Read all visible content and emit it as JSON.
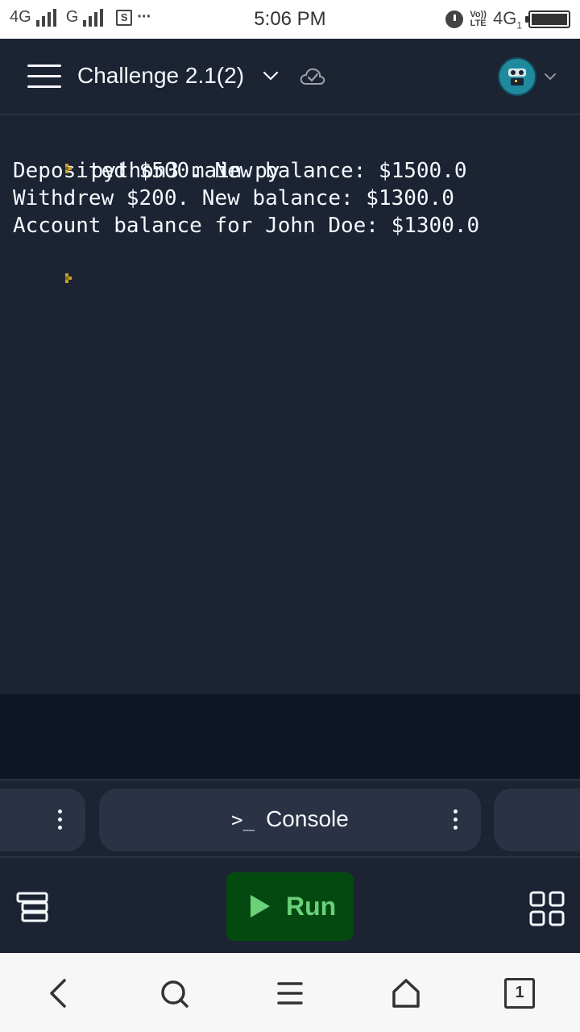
{
  "status_bar": {
    "network1": "4G",
    "network2": "G",
    "sim_label": "S",
    "more": "···",
    "time": "5:06 PM",
    "volte_top": "Vo))",
    "volte_bottom": "LTE",
    "network3": "4G",
    "network3_sub": "1"
  },
  "header": {
    "title": "Challenge 2.1(2)"
  },
  "console": {
    "command": "python3 main.py",
    "output": [
      "Deposited $500. New balance: $1500.0",
      "Withdrew $200. New balance: $1300.0",
      "Account balance for John Doe: $1300.0"
    ]
  },
  "tabs": {
    "console_glyph": ">_",
    "console_label": "Console"
  },
  "run_bar": {
    "run_label": "Run"
  },
  "nav": {
    "recent_count": "1"
  },
  "colors": {
    "background": "#1c2333",
    "run_button": "#044a10",
    "run_text": "#6ad17a",
    "prompt": "#c9a227"
  }
}
